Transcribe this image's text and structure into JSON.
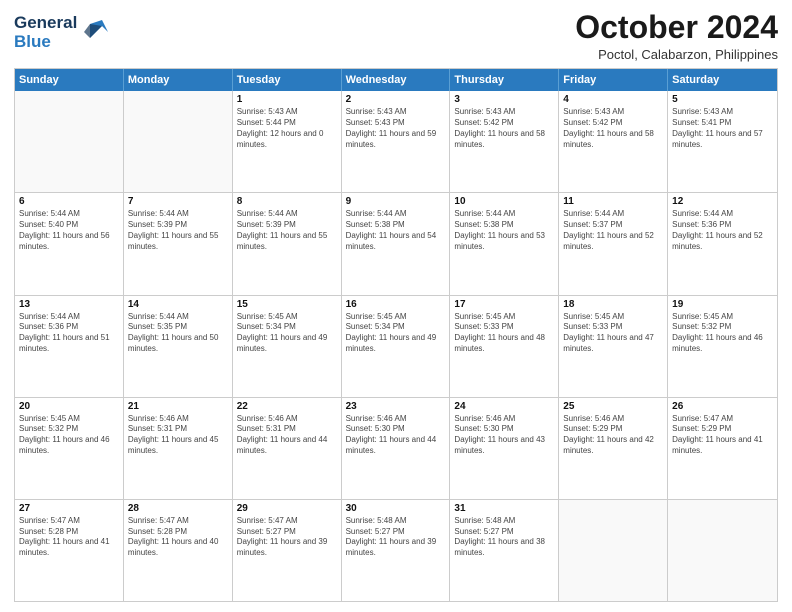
{
  "header": {
    "logo_line1": "General",
    "logo_line2": "Blue",
    "month": "October 2024",
    "location": "Poctol, Calabarzon, Philippines"
  },
  "weekdays": [
    "Sunday",
    "Monday",
    "Tuesday",
    "Wednesday",
    "Thursday",
    "Friday",
    "Saturday"
  ],
  "rows": [
    [
      {
        "day": "",
        "sunrise": "",
        "sunset": "",
        "daylight": "",
        "empty": true
      },
      {
        "day": "",
        "sunrise": "",
        "sunset": "",
        "daylight": "",
        "empty": true
      },
      {
        "day": "1",
        "sunrise": "Sunrise: 5:43 AM",
        "sunset": "Sunset: 5:44 PM",
        "daylight": "Daylight: 12 hours and 0 minutes."
      },
      {
        "day": "2",
        "sunrise": "Sunrise: 5:43 AM",
        "sunset": "Sunset: 5:43 PM",
        "daylight": "Daylight: 11 hours and 59 minutes."
      },
      {
        "day": "3",
        "sunrise": "Sunrise: 5:43 AM",
        "sunset": "Sunset: 5:42 PM",
        "daylight": "Daylight: 11 hours and 58 minutes."
      },
      {
        "day": "4",
        "sunrise": "Sunrise: 5:43 AM",
        "sunset": "Sunset: 5:42 PM",
        "daylight": "Daylight: 11 hours and 58 minutes."
      },
      {
        "day": "5",
        "sunrise": "Sunrise: 5:43 AM",
        "sunset": "Sunset: 5:41 PM",
        "daylight": "Daylight: 11 hours and 57 minutes."
      }
    ],
    [
      {
        "day": "6",
        "sunrise": "Sunrise: 5:44 AM",
        "sunset": "Sunset: 5:40 PM",
        "daylight": "Daylight: 11 hours and 56 minutes."
      },
      {
        "day": "7",
        "sunrise": "Sunrise: 5:44 AM",
        "sunset": "Sunset: 5:39 PM",
        "daylight": "Daylight: 11 hours and 55 minutes."
      },
      {
        "day": "8",
        "sunrise": "Sunrise: 5:44 AM",
        "sunset": "Sunset: 5:39 PM",
        "daylight": "Daylight: 11 hours and 55 minutes."
      },
      {
        "day": "9",
        "sunrise": "Sunrise: 5:44 AM",
        "sunset": "Sunset: 5:38 PM",
        "daylight": "Daylight: 11 hours and 54 minutes."
      },
      {
        "day": "10",
        "sunrise": "Sunrise: 5:44 AM",
        "sunset": "Sunset: 5:38 PM",
        "daylight": "Daylight: 11 hours and 53 minutes."
      },
      {
        "day": "11",
        "sunrise": "Sunrise: 5:44 AM",
        "sunset": "Sunset: 5:37 PM",
        "daylight": "Daylight: 11 hours and 52 minutes."
      },
      {
        "day": "12",
        "sunrise": "Sunrise: 5:44 AM",
        "sunset": "Sunset: 5:36 PM",
        "daylight": "Daylight: 11 hours and 52 minutes."
      }
    ],
    [
      {
        "day": "13",
        "sunrise": "Sunrise: 5:44 AM",
        "sunset": "Sunset: 5:36 PM",
        "daylight": "Daylight: 11 hours and 51 minutes."
      },
      {
        "day": "14",
        "sunrise": "Sunrise: 5:44 AM",
        "sunset": "Sunset: 5:35 PM",
        "daylight": "Daylight: 11 hours and 50 minutes."
      },
      {
        "day": "15",
        "sunrise": "Sunrise: 5:45 AM",
        "sunset": "Sunset: 5:34 PM",
        "daylight": "Daylight: 11 hours and 49 minutes."
      },
      {
        "day": "16",
        "sunrise": "Sunrise: 5:45 AM",
        "sunset": "Sunset: 5:34 PM",
        "daylight": "Daylight: 11 hours and 49 minutes."
      },
      {
        "day": "17",
        "sunrise": "Sunrise: 5:45 AM",
        "sunset": "Sunset: 5:33 PM",
        "daylight": "Daylight: 11 hours and 48 minutes."
      },
      {
        "day": "18",
        "sunrise": "Sunrise: 5:45 AM",
        "sunset": "Sunset: 5:33 PM",
        "daylight": "Daylight: 11 hours and 47 minutes."
      },
      {
        "day": "19",
        "sunrise": "Sunrise: 5:45 AM",
        "sunset": "Sunset: 5:32 PM",
        "daylight": "Daylight: 11 hours and 46 minutes."
      }
    ],
    [
      {
        "day": "20",
        "sunrise": "Sunrise: 5:45 AM",
        "sunset": "Sunset: 5:32 PM",
        "daylight": "Daylight: 11 hours and 46 minutes."
      },
      {
        "day": "21",
        "sunrise": "Sunrise: 5:46 AM",
        "sunset": "Sunset: 5:31 PM",
        "daylight": "Daylight: 11 hours and 45 minutes."
      },
      {
        "day": "22",
        "sunrise": "Sunrise: 5:46 AM",
        "sunset": "Sunset: 5:31 PM",
        "daylight": "Daylight: 11 hours and 44 minutes."
      },
      {
        "day": "23",
        "sunrise": "Sunrise: 5:46 AM",
        "sunset": "Sunset: 5:30 PM",
        "daylight": "Daylight: 11 hours and 44 minutes."
      },
      {
        "day": "24",
        "sunrise": "Sunrise: 5:46 AM",
        "sunset": "Sunset: 5:30 PM",
        "daylight": "Daylight: 11 hours and 43 minutes."
      },
      {
        "day": "25",
        "sunrise": "Sunrise: 5:46 AM",
        "sunset": "Sunset: 5:29 PM",
        "daylight": "Daylight: 11 hours and 42 minutes."
      },
      {
        "day": "26",
        "sunrise": "Sunrise: 5:47 AM",
        "sunset": "Sunset: 5:29 PM",
        "daylight": "Daylight: 11 hours and 41 minutes."
      }
    ],
    [
      {
        "day": "27",
        "sunrise": "Sunrise: 5:47 AM",
        "sunset": "Sunset: 5:28 PM",
        "daylight": "Daylight: 11 hours and 41 minutes."
      },
      {
        "day": "28",
        "sunrise": "Sunrise: 5:47 AM",
        "sunset": "Sunset: 5:28 PM",
        "daylight": "Daylight: 11 hours and 40 minutes."
      },
      {
        "day": "29",
        "sunrise": "Sunrise: 5:47 AM",
        "sunset": "Sunset: 5:27 PM",
        "daylight": "Daylight: 11 hours and 39 minutes."
      },
      {
        "day": "30",
        "sunrise": "Sunrise: 5:48 AM",
        "sunset": "Sunset: 5:27 PM",
        "daylight": "Daylight: 11 hours and 39 minutes."
      },
      {
        "day": "31",
        "sunrise": "Sunrise: 5:48 AM",
        "sunset": "Sunset: 5:27 PM",
        "daylight": "Daylight: 11 hours and 38 minutes."
      },
      {
        "day": "",
        "sunrise": "",
        "sunset": "",
        "daylight": "",
        "empty": true
      },
      {
        "day": "",
        "sunrise": "",
        "sunset": "",
        "daylight": "",
        "empty": true
      }
    ]
  ]
}
